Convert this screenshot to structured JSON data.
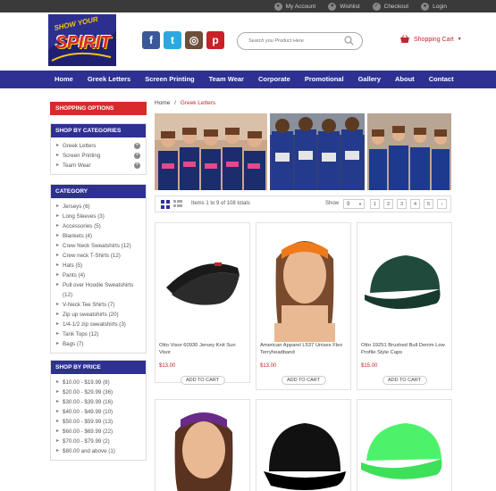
{
  "topbar": {
    "links": [
      {
        "label": "My Account",
        "icon": "user-icon"
      },
      {
        "label": "Wishlist",
        "icon": "heart-icon"
      },
      {
        "label": "Checkout",
        "icon": "checkout-icon"
      },
      {
        "label": "Login",
        "icon": "lock-icon"
      }
    ]
  },
  "header": {
    "logo_top": "SHOW YOUR",
    "logo_main": "SPIRIT",
    "search_placeholder": "Search you Product Here",
    "cart_label": "Shopping Cart"
  },
  "nav": {
    "items": [
      "Home",
      "Greek Letters",
      "Screen Printing",
      "Team Wear",
      "Corporate",
      "Promotional",
      "Gallery",
      "About",
      "Contact"
    ]
  },
  "sidebar": {
    "shopping_options": "Shopping Options",
    "by_categories": {
      "title": "Shop By Categories",
      "items": [
        "Greek Letters",
        "Screen Printing",
        "Team Wear"
      ]
    },
    "category": {
      "title": "Category",
      "items": [
        "Jerseys (6)",
        "Long Sleeves (3)",
        "Accessories (5)",
        "Blankets (4)",
        "Crew Neck Sweatshirts (12)",
        "Crew neck T-Shirts (12)",
        "Hats (5)",
        "Pants (4)",
        "Pull over Hoodie Sweatshirts (12)",
        "V-Neck Tee Shirts (7)",
        "Zip up sweatshirts (20)",
        "1/4-1/2 zip sweatshirts (3)",
        "Tank Tops (12)",
        "Bags (7)"
      ]
    },
    "by_price": {
      "title": "Shop By Price",
      "items": [
        "$10.00 - $19.99 (8)",
        "$20.00 - $29.99 (36)",
        "$30.00 - $39.99 (16)",
        "$40.00 - $49.99 (10)",
        "$50.00 - $59.99 (13)",
        "$60.00 - $69.99 (22)",
        "$70.00 - $79.99 (2)",
        "$80.00 and above (1)"
      ]
    }
  },
  "breadcrumb": {
    "home": "Home",
    "sep": "/",
    "current": "Greek Letters"
  },
  "toolbar": {
    "count_text": "Items 1 to 9 of 108 totals",
    "show_label": "Show",
    "show_value": "9",
    "pages": [
      "1",
      "2",
      "3",
      "4",
      "5",
      "›"
    ]
  },
  "products": [
    {
      "name": "Otto Visor 60930 Jersey Knit Sun Visor",
      "price": "$13.00",
      "add": "ADD TO CART",
      "icon": "visor-image"
    },
    {
      "name": "American Apparel L537 Unisex Flex Terryheadband",
      "price": "$13.00",
      "add": "ADD TO CART",
      "icon": "headband-image"
    },
    {
      "name": "Otto 19251 Brushed Bull Denim Low Profile Style Caps",
      "price": "$15.00",
      "add": "ADD TO CART",
      "icon": "cap-image"
    },
    {
      "name": "",
      "price": "",
      "add": "",
      "icon": "headband-purple-image"
    },
    {
      "name": "",
      "price": "",
      "add": "",
      "icon": "trucker-cap-image"
    },
    {
      "name": "",
      "price": "",
      "add": "",
      "icon": "neon-cap-image"
    }
  ],
  "colors": {
    "nav": "#2e3192",
    "accent": "#d82a2a",
    "price": "#c0272d"
  }
}
